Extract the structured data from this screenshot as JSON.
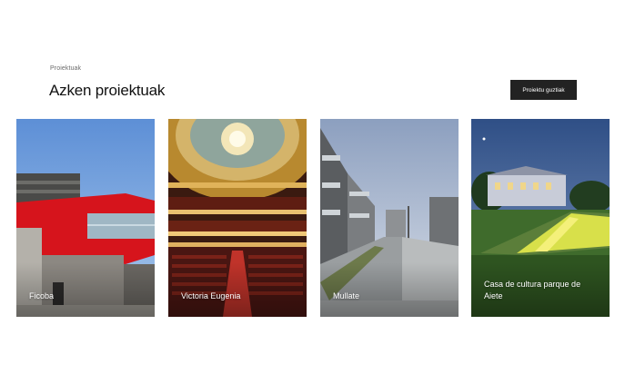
{
  "section": {
    "eyebrow": "Proiektuak",
    "title": "Azken proiektuak",
    "all_button_label": "Proiektu guztiak"
  },
  "projects": [
    {
      "name": "Ficoba"
    },
    {
      "name": "Victoria Eugenia"
    },
    {
      "name": "Mullate"
    },
    {
      "name": "Casa de cultura parque de Aiete"
    }
  ]
}
